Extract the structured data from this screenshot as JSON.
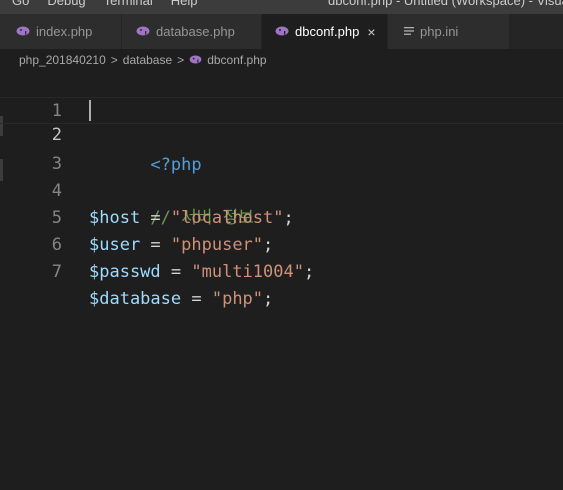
{
  "menu": {
    "items": [
      "Go",
      "Debug",
      "Terminal",
      "Help"
    ],
    "window_title": "dbconf.php - Untitled (Workspace) - Visual S"
  },
  "tabs": [
    {
      "label": "index.php",
      "icon": "php-elephant-icon",
      "active": false
    },
    {
      "label": "database.php",
      "icon": "php-elephant-icon",
      "active": false
    },
    {
      "label": "dbconf.php",
      "icon": "php-elephant-icon",
      "active": true,
      "close": "×"
    },
    {
      "label": "php.ini",
      "icon": "lines-icon",
      "active": false
    }
  ],
  "breadcrumb": {
    "items": [
      "php_201840210",
      "database",
      "dbconf.php"
    ],
    "separator": ">"
  },
  "editor": {
    "lines": [
      {
        "number": "1",
        "tokens": [
          {
            "t": "<?php",
            "c": "kw"
          }
        ]
      },
      {
        "number": "2",
        "tokens": []
      },
      {
        "number": "3",
        "tokens": [
          {
            "t": "// 서버 정보",
            "c": "cmt"
          }
        ]
      },
      {
        "number": "4",
        "tokens": [
          {
            "t": "$host",
            "c": "var"
          },
          {
            "t": " = ",
            "c": "op"
          },
          {
            "t": "\"localhost\"",
            "c": "str"
          },
          {
            "t": ";",
            "c": "op"
          }
        ]
      },
      {
        "number": "5",
        "tokens": [
          {
            "t": "$user",
            "c": "var"
          },
          {
            "t": " = ",
            "c": "op"
          },
          {
            "t": "\"phpuser\"",
            "c": "str"
          },
          {
            "t": ";",
            "c": "op"
          }
        ]
      },
      {
        "number": "6",
        "tokens": [
          {
            "t": "$passwd",
            "c": "var"
          },
          {
            "t": " = ",
            "c": "op"
          },
          {
            "t": "\"multi1004\"",
            "c": "str"
          },
          {
            "t": ";",
            "c": "op"
          }
        ]
      },
      {
        "number": "7",
        "tokens": [
          {
            "t": "$database",
            "c": "var"
          },
          {
            "t": " = ",
            "c": "op"
          },
          {
            "t": "\"php\"",
            "c": "str"
          },
          {
            "t": ";",
            "c": "op"
          }
        ]
      }
    ],
    "current_line": 2
  },
  "colors": {
    "keyword": "#569cd6",
    "variable": "#9cdcfe",
    "string": "#ce9178",
    "comment": "#6a9955",
    "php_icon": "#a074c4"
  }
}
